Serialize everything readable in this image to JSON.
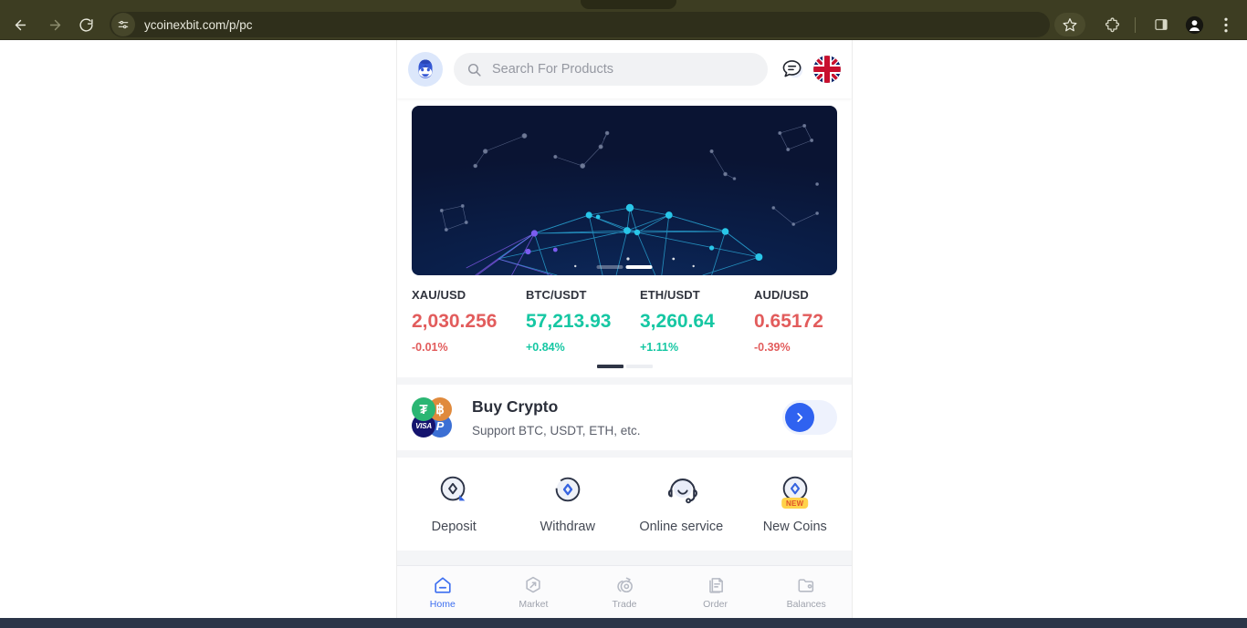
{
  "browser": {
    "url": "ycoinexbit.com/p/pc",
    "back_label": "Back",
    "forward_label": "Forward",
    "reload_label": "Reload",
    "site_info_label": "View site information",
    "bookmark_label": "Bookmark this tab",
    "extensions_label": "Extensions",
    "side_panel_label": "Side panel",
    "profile_label": "Profile",
    "menu_label": "Customize and control Chrome",
    "chrome_theme_color": "#3d3d22"
  },
  "app": {
    "header": {
      "logo_name": "penguin-mascot-avatar",
      "search": {
        "placeholder": "Search For Products",
        "value": ""
      },
      "chat_label": "Customer chat",
      "language_label": "English"
    },
    "banner": {
      "alt": "Crypto network constellation banner",
      "slides": 2,
      "active_slide": 2
    },
    "tickers": {
      "items": [
        {
          "pair": "XAU/USD",
          "price": "2,030.256",
          "change": "-0.01%",
          "direction": "down"
        },
        {
          "pair": "BTC/USDT",
          "price": "57,213.93",
          "change": "+0.84%",
          "direction": "up"
        },
        {
          "pair": "ETH/USDT",
          "price": "3,260.64",
          "change": "+1.11%",
          "direction": "up"
        },
        {
          "pair": "AUD/USD",
          "price": "0.65172",
          "change": "-0.39%",
          "direction": "down"
        }
      ],
      "pages": 2,
      "active_page": 1,
      "up_color": "#16c7a3",
      "down_color": "#e25c5c"
    },
    "buy_crypto": {
      "title": "Buy Crypto",
      "subtitle": "Support BTC, USDT, ETH, etc.",
      "badges": [
        "Tether",
        "Bitcoin",
        "VISA",
        "PayPal"
      ],
      "tether_symbol": "₮",
      "bitcoin_symbol": "฿",
      "visa_symbol": "VISA",
      "paypal_symbol": "P",
      "arrow_label": "Go"
    },
    "quick_actions": [
      {
        "label": "Deposit",
        "icon": "deposit-icon"
      },
      {
        "label": "Withdraw",
        "icon": "withdraw-icon"
      },
      {
        "label": "Online service",
        "icon": "headset-icon"
      },
      {
        "label": "New Coins",
        "icon": "new-coins-icon",
        "badge": "NEW"
      }
    ],
    "bottom_nav": {
      "active": "Home",
      "items": [
        {
          "label": "Home",
          "icon": "home-icon"
        },
        {
          "label": "Market",
          "icon": "market-icon"
        },
        {
          "label": "Trade",
          "icon": "trade-icon"
        },
        {
          "label": "Order",
          "icon": "order-icon"
        },
        {
          "label": "Balances",
          "icon": "balances-icon"
        }
      ]
    },
    "accent_color": "#3c6ef0"
  }
}
